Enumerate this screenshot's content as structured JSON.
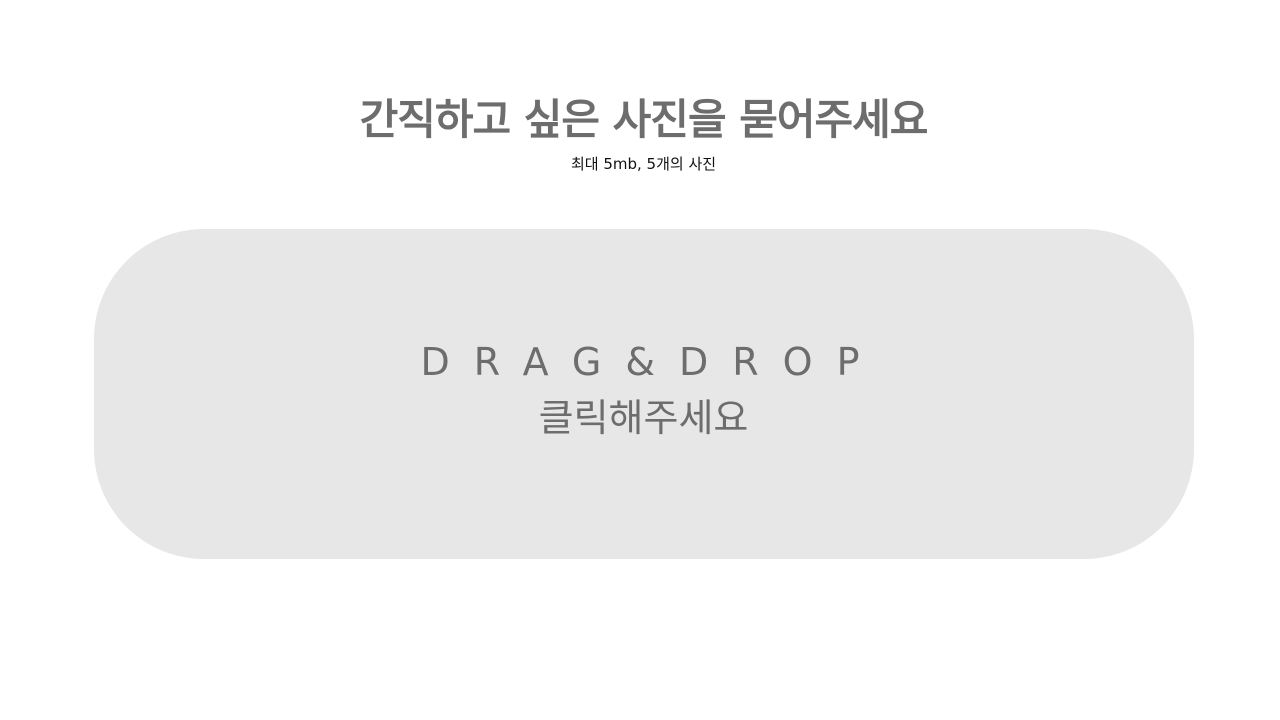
{
  "header": {
    "title": "간직하고 싶은 사진을 묻어주세요",
    "subtitle": "최대 5mb, 5개의 사진"
  },
  "dropzone": {
    "main_label": "DRAG&DROP",
    "sub_label": "클릭해주세요"
  },
  "colors": {
    "background": "#ffffff",
    "dropzone_fill": "#e7e7e7",
    "text_gray": "#6d6d6d",
    "text_dark": "#111111"
  }
}
